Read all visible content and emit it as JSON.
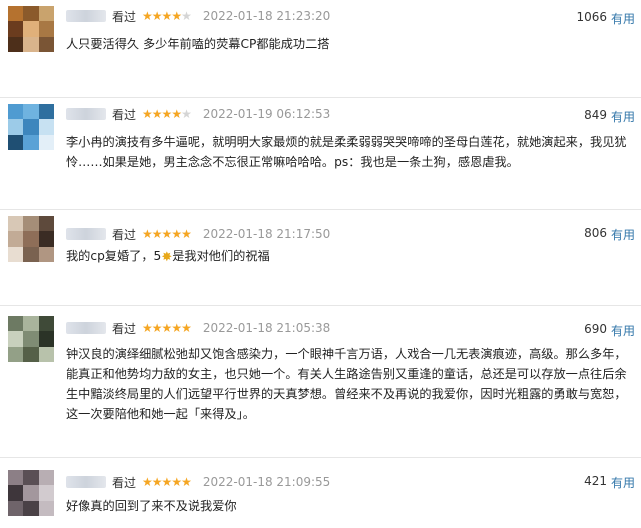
{
  "comments": [
    {
      "status": "看过",
      "stars_filled": 4,
      "date": "2022-01-18 21:23:20",
      "votes": "1066",
      "useful_label": "有用",
      "text": "人只要活得久 多少年前嗑的荧幕CP都能成功二搭",
      "avatar_colors": [
        "#b5722f",
        "#8b5a2b",
        "#c9a36d",
        "#6b3c1e",
        "#e0b07a",
        "#a87844",
        "#4d2f1a",
        "#d9b48c",
        "#7a5535"
      ]
    },
    {
      "status": "看过",
      "stars_filled": 4,
      "date": "2022-01-19 06:12:53",
      "votes": "849",
      "useful_label": "有用",
      "text": "李小冉的演技有多牛逼呢，就明明大家最烦的就是柔柔弱弱哭哭啼啼的圣母白莲花，就她演起来，我见犹怜……如果是她，男主念念不忘很正常嘛哈哈哈。ps：我也是一条土狗，感恩虐我。",
      "avatar_colors": [
        "#4f9bd1",
        "#6fb3e0",
        "#2f6f9f",
        "#9ccbe8",
        "#3d86bd",
        "#c7e1f2",
        "#1f4f73",
        "#5aa2d6",
        "#e3eff8"
      ]
    },
    {
      "status": "看过",
      "stars_filled": 5,
      "date": "2022-01-18 21:17:50",
      "votes": "806",
      "useful_label": "有用",
      "text_before": "我的cp复婚了，5",
      "text_after": "是我对他们的祝福",
      "avatar_colors": [
        "#d8c8b6",
        "#a58e78",
        "#5e4a3c",
        "#c2ab96",
        "#8e6e58",
        "#3a2c24",
        "#e8ddd1",
        "#7a6250",
        "#b09682"
      ]
    },
    {
      "status": "看过",
      "stars_filled": 5,
      "date": "2022-01-18 21:05:38",
      "votes": "690",
      "useful_label": "有用",
      "text": "钟汉良的演绎细腻松弛却又饱含感染力，一个眼神千言万语，人戏合一几无表演痕迹，高级。那么多年，能真正和他势均力敌的女主，也只她一个。有关人生路途告别又重逢的童话，总还是可以存放一点往后余生中黯淡终局里的人们远望平行世界的天真梦想。曾经来不及再说的我爱你，因时光粗露的勇敢与宽恕，这一次要陪他和她一起「来得及」。",
      "avatar_colors": [
        "#6d7a63",
        "#a9b49c",
        "#3f4a38",
        "#c8d0bd",
        "#7f8c74",
        "#2b3327",
        "#93a087",
        "#556048",
        "#b8c2ab"
      ]
    },
    {
      "status": "看过",
      "stars_filled": 5,
      "date": "2022-01-18 21:09:55",
      "votes": "421",
      "useful_label": "有用",
      "text": "好像真的回到了来不及说我爱你",
      "avatar_colors": [
        "#8c7f86",
        "#5a4f55",
        "#b8aeb3",
        "#3e363b",
        "#a3979d",
        "#d2cbcf",
        "#6f646a",
        "#4a4146",
        "#c4bbc0"
      ]
    }
  ]
}
